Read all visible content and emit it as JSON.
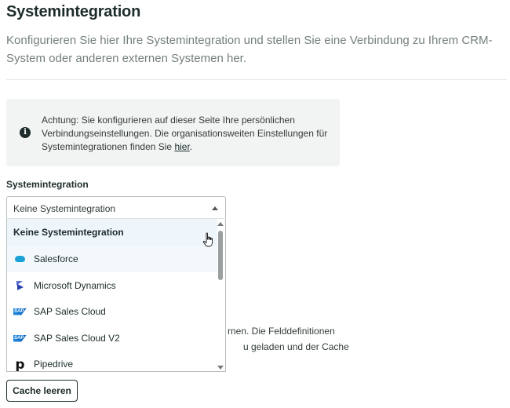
{
  "header": {
    "title": "Systemintegration",
    "description": "Konfigurieren Sie hier Ihre Systemintegration und stellen Sie eine Verbindung zu Ihrem CRM-System oder anderen externen Systemen her."
  },
  "notice": {
    "icon": "info-icon",
    "text": "Achtung: Sie konfigurieren auf dieser Seite Ihre persönlichen Verbindungseinstellungen. Die organisationsweiten Einstellungen für Systemintegrationen finden Sie ",
    "link_label": "hier",
    "suffix": "."
  },
  "integration_field": {
    "label": "Systemintegration",
    "selected_value": "Keine Systemintegration",
    "options": [
      {
        "label": "Keine Systemintegration",
        "icon": ""
      },
      {
        "label": "Salesforce",
        "icon": "salesforce-icon"
      },
      {
        "label": "Microsoft Dynamics",
        "icon": "microsoft-dynamics-icon"
      },
      {
        "label": "SAP Sales Cloud",
        "icon": "sap-icon"
      },
      {
        "label": "SAP Sales Cloud V2",
        "icon": "sap-icon"
      },
      {
        "label": "Pipedrive",
        "icon": "pipedrive-icon"
      }
    ]
  },
  "partial_text": {
    "line1": "rnen. Die Felddefinitionen",
    "line2": "u geladen und der Cache"
  },
  "cache_button": {
    "label": "Cache leeren"
  },
  "colors": {
    "accent_selected_bg": "#eef5fb",
    "text_dark": "#1d2b2b",
    "salesforce": "#1ba0d8",
    "sap": "#0a60c0"
  }
}
